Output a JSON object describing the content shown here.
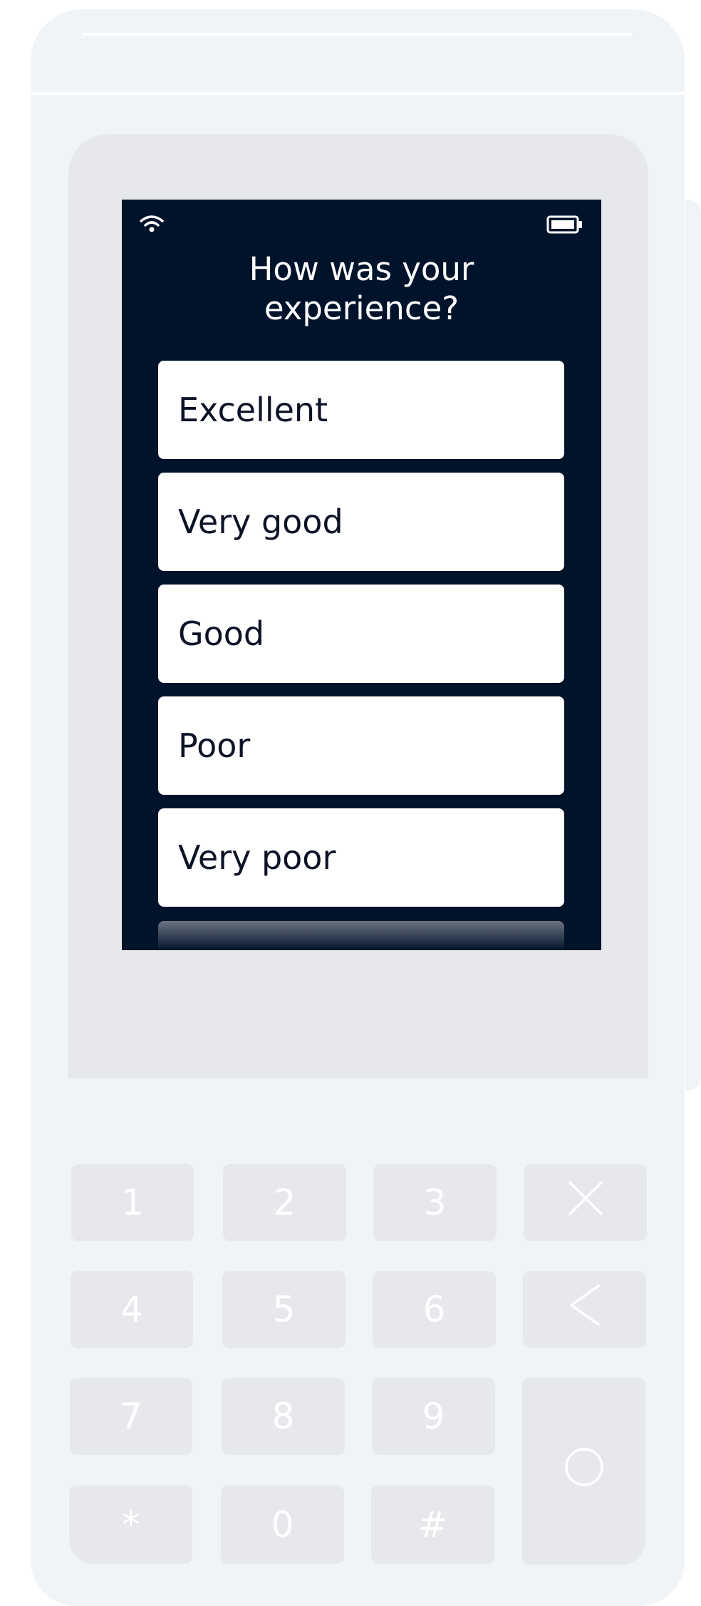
{
  "screen": {
    "question": "How was your experience?",
    "options": [
      "Excellent",
      "Very good",
      "Good",
      "Poor",
      "Very poor"
    ],
    "status": {
      "left_icon": "wifi-icon",
      "right_icon": "battery-icon"
    }
  },
  "keypad": {
    "keys": {
      "k1": "1",
      "k2": "2",
      "k3": "3",
      "k4": "4",
      "k5": "5",
      "k6": "6",
      "k7": "7",
      "k8": "8",
      "k9": "9",
      "kstar": "*",
      "k0": "0",
      "khash": "#"
    },
    "icons": {
      "cancel": "close-icon",
      "clear": "chevron-left-icon",
      "confirm": "circle-icon"
    }
  },
  "colors": {
    "device_body": "#f1f4f7",
    "bezel": "#e6e8ec",
    "screen_background": "#00132b",
    "option_background": "#ffffff",
    "option_text": "#0d1226",
    "key_label": "#ffffff"
  }
}
